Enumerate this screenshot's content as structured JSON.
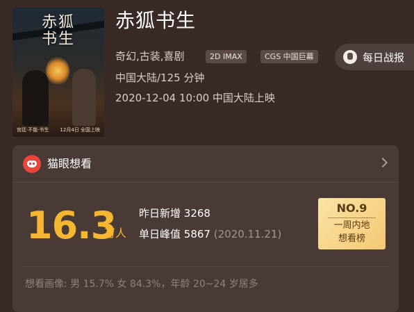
{
  "movie": {
    "title": "赤狐书生",
    "genres": "奇幻,古装,喜剧",
    "tags": [
      "2D IMAX",
      "CGS 中国巨幕"
    ],
    "region_duration": "中国大陆/125 分钟",
    "release": "2020-12-04 10:00 中国大陆上映"
  },
  "poster": {
    "title_text": "赤狐书生",
    "caption_left": "宫廷·不能·书生",
    "caption_right": "12月4日 全国上映"
  },
  "daily_report": {
    "label": "每日战报"
  },
  "want_card": {
    "title": "猫眼想看",
    "count": "16.3",
    "unit": "万人",
    "yesterday_label": "昨日新增",
    "yesterday_value": "3268",
    "peak_label": "单日峰值",
    "peak_value": "5867",
    "peak_date": "(2020.11.21)",
    "rank_no": "NO.9",
    "rank_line1": "一周内地",
    "rank_line2": "想看榜",
    "portrait": "想看画像: 男 15.7%  女 84.3%，年龄 20~24 岁居多"
  },
  "colors": {
    "background": "#3a2a26",
    "card": "#4a3a35",
    "accent": "#f5b731",
    "logo_red": "#e8453c"
  }
}
